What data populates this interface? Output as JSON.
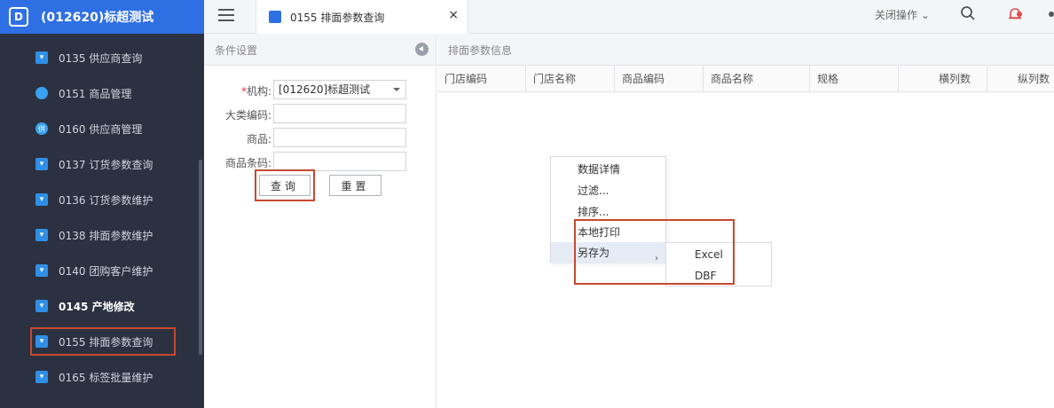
{
  "app": {
    "title": "(012620)标超测试",
    "logo_text": "D"
  },
  "sidebar": {
    "items": [
      {
        "label": "0135 供应商查询",
        "icon": "cart-icon"
      },
      {
        "label": "0151 商品管理",
        "icon": "database-icon"
      },
      {
        "label": "0160 供应商管理",
        "icon": "supplier-icon",
        "icon_text": "供"
      },
      {
        "label": "0137 订货参数查询",
        "icon": "cart-icon"
      },
      {
        "label": "0136 订货参数维护",
        "icon": "cart-icon"
      },
      {
        "label": "0138 排面参数维护",
        "icon": "cart-icon"
      },
      {
        "label": "0140 团购客户维护",
        "icon": "cart-icon"
      },
      {
        "label": "0145 产地修改",
        "icon": "cart-icon"
      },
      {
        "label": "0155 排面参数查询",
        "icon": "cart-icon"
      },
      {
        "label": "0165 标签批量维护",
        "icon": "cart-icon"
      }
    ]
  },
  "topbar": {
    "tab_label": "0155 排面参数查询",
    "tab_close": "×",
    "close_ops": "关闭操作 ⌄"
  },
  "left_panel": {
    "title": "条件设置",
    "fields": {
      "org_required": "*",
      "org_label": "机构:",
      "org_value": "[012620]标超测试",
      "category_label": "大类编码:",
      "category_value": "",
      "goods_label": "商品:",
      "goods_value": "",
      "barcode_label": "商品条码:",
      "barcode_value": ""
    },
    "query_button": "查询",
    "reset_button": "重置"
  },
  "right_panel": {
    "title": "排面参数信息",
    "columns": [
      "门店编码",
      "门店名称",
      "商品编码",
      "商品名称",
      "规格",
      "横列数",
      "纵列数"
    ]
  },
  "context_menu": {
    "items": [
      "数据详情",
      "过滤...",
      "排序...",
      "本地打印",
      "另存为"
    ],
    "submenu": [
      "Excel",
      "DBF"
    ],
    "submenu_arrow": "›"
  },
  "colors": {
    "accent": "#2f6fe4",
    "sidebar_bg": "#2b3141",
    "highlight": "#c8492e"
  }
}
